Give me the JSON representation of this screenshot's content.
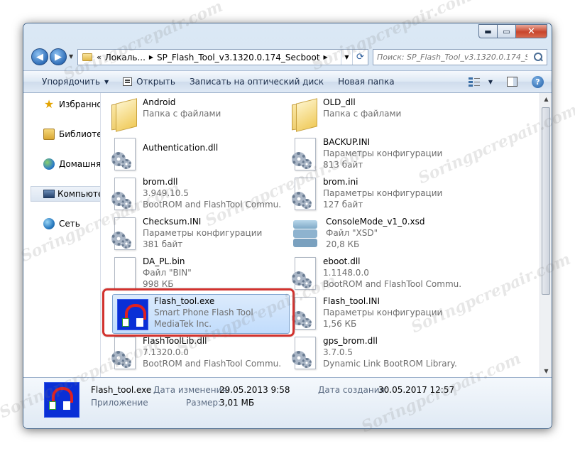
{
  "window": {
    "caption_buttons": {
      "minimize_icon": "minimize-icon",
      "maximize_icon": "maximize-icon",
      "close_icon": "close-icon"
    }
  },
  "address": {
    "chevron": "«",
    "parts": [
      "Локаль...",
      "SP_Flash_Tool_v3.1320.0.174_Secboot"
    ],
    "search_placeholder": "Поиск: SP_Flash_Tool_v3.1320.0.174_Se..."
  },
  "toolbar": {
    "organize": "Упорядочить",
    "open": "Открыть",
    "burn": "Записать на оптический диск",
    "new_folder": "Новая папка",
    "help": "?"
  },
  "sidebar": {
    "items": [
      {
        "label": "Избранное",
        "icon": "star-icon"
      },
      {
        "label": "Библиотеки",
        "icon": "libraries-icon"
      },
      {
        "label": "Домашняя",
        "icon": "homegroup-icon"
      },
      {
        "label": "Компьютер",
        "icon": "computer-icon"
      },
      {
        "label": "Сеть",
        "icon": "network-icon"
      }
    ]
  },
  "files": [
    {
      "name": "Android",
      "l2": "Папка с файлами",
      "l3": "",
      "icon": "folder-icon"
    },
    {
      "name": "OLD_dll",
      "l2": "Папка с файлами",
      "l3": "",
      "icon": "folder-icon"
    },
    {
      "name": "Authentication.dll",
      "l2": "",
      "l3": "",
      "icon": "dll-icon"
    },
    {
      "name": "BACKUP.INI",
      "l2": "Параметры конфигурации",
      "l3": "813 байт",
      "icon": "config-file-icon"
    },
    {
      "name": "brom.dll",
      "l2": "3.949.10.5",
      "l3": "BootROM and FlashTool Commu...",
      "icon": "dll-icon"
    },
    {
      "name": "brom.ini",
      "l2": "Параметры конфигурации",
      "l3": "127 байт",
      "icon": "config-file-icon"
    },
    {
      "name": "Checksum.INI",
      "l2": "Параметры конфигурации",
      "l3": "381 байт",
      "icon": "config-file-icon"
    },
    {
      "name": "ConsoleMode_v1_0.xsd",
      "l2": "Файл \"XSD\"",
      "l3": "20,8 КБ",
      "icon": "xsd-file-icon"
    },
    {
      "name": "DA_PL.bin",
      "l2": "Файл \"BIN\"",
      "l3": "998 КБ",
      "icon": "bin-file-icon"
    },
    {
      "name": "eboot.dll",
      "l2": "1.1148.0.0",
      "l3": "BootROM and FlashTool Commu...",
      "icon": "dll-icon"
    },
    {
      "name": "Flash_tool.exe",
      "l2": "Smart Phone Flash Tool",
      "l3": "MediaTek Inc.",
      "icon": "flash-tool-app-icon"
    },
    {
      "name": "Flash_tool.INI",
      "l2": "Параметры конфигурации",
      "l3": "1,56 КБ",
      "icon": "config-file-icon"
    },
    {
      "name": "FlashToolLib.dll",
      "l2": "7.1320.0.0",
      "l3": "BootROM and FlashTool Commu...",
      "icon": "dll-icon"
    },
    {
      "name": "gps_brom.dll",
      "l2": "3.7.0.5",
      "l3": "Dynamic Link BootROM Library.",
      "icon": "dll-icon"
    }
  ],
  "details": {
    "name": "Flash_tool.exe",
    "type": "Приложение",
    "modified_label": "Дата изменения:",
    "modified_value": "29.05.2013 9:58",
    "size_label": "Размер:",
    "size_value": "3,01 МБ",
    "created_label": "Дата создания:",
    "created_value": "30.05.2017 12:57"
  },
  "watermark": "Soringpcrepair.com",
  "colors": {
    "highlight": "#d2322e",
    "selection": "#c1dcfc",
    "accent": "#2f6fb9"
  }
}
